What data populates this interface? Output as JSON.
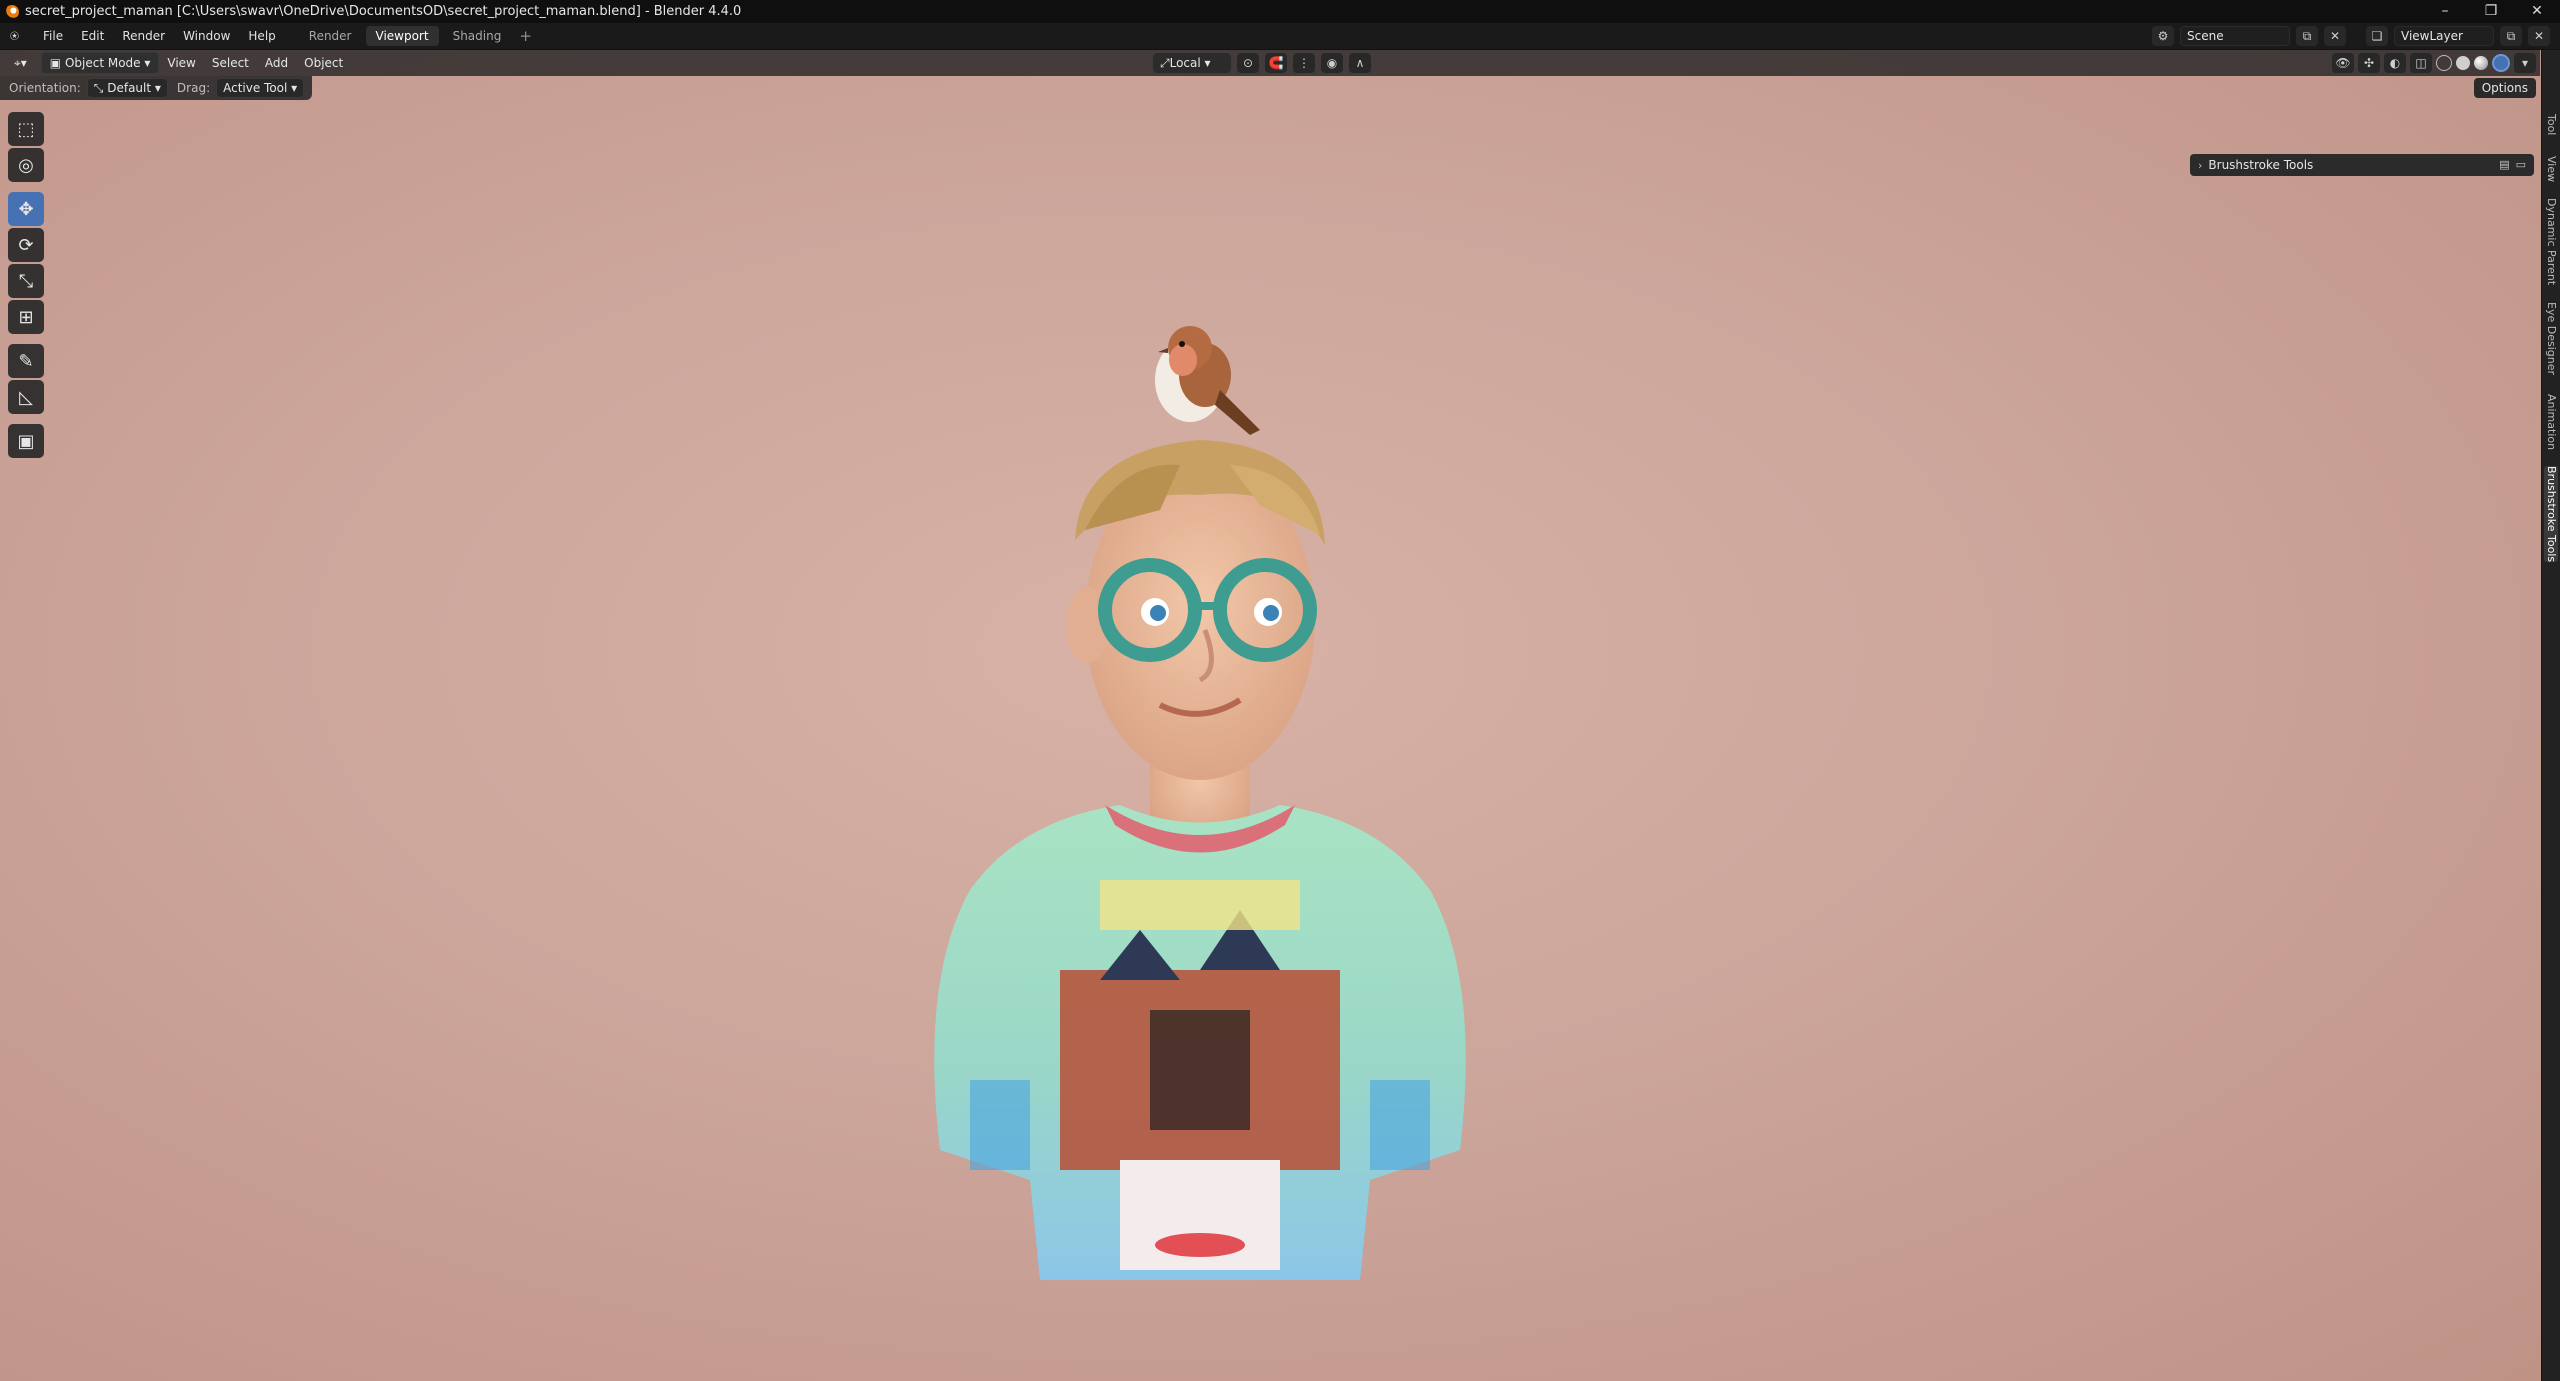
{
  "window": {
    "title": "secret_project_maman [C:\\Users\\swavr\\OneDrive\\DocumentsOD\\secret_project_maman.blend] - Blender 4.4.0",
    "controls": {
      "minimize": "–",
      "restore": "❐",
      "close": "✕"
    }
  },
  "menu": {
    "items": [
      "File",
      "Edit",
      "Render",
      "Window",
      "Help"
    ],
    "workspaces": [
      {
        "label": "Render",
        "active": false
      },
      {
        "label": "Viewport",
        "active": true
      },
      {
        "label": "Shading",
        "active": false
      }
    ],
    "add_workspace": "+",
    "scene": "Scene",
    "view_layer": "ViewLayer"
  },
  "viewport_header": {
    "mode": "Object Mode",
    "menus": [
      "View",
      "Select",
      "Add",
      "Object"
    ],
    "transform_orientation": "Local"
  },
  "tool_settings": {
    "orientation_label": "Orientation:",
    "orientation_value": "Default",
    "drag_label": "Drag:",
    "drag_value": "Active Tool",
    "options": "Options"
  },
  "toolbar": {
    "tools": [
      {
        "name": "select-box-tool",
        "glyph": "⬚",
        "active": false
      },
      {
        "name": "cursor-tool",
        "glyph": "◎",
        "active": false
      },
      {
        "name": "move-tool",
        "glyph": "✥",
        "active": true
      },
      {
        "name": "rotate-tool",
        "glyph": "⟳",
        "active": false
      },
      {
        "name": "scale-tool",
        "glyph": "⤡",
        "active": false
      },
      {
        "name": "transform-tool",
        "glyph": "⊞",
        "active": false
      },
      {
        "name": "annotate-tool",
        "glyph": "✎",
        "active": false
      },
      {
        "name": "measure-tool",
        "glyph": "📐",
        "active": false
      },
      {
        "name": "add-cube-tool",
        "glyph": "▣",
        "active": false
      }
    ]
  },
  "n_panel": {
    "tabs": [
      "Tool",
      "View",
      "Dynamic Parent",
      "Eye Designer",
      "Animation",
      "Brushstroke Tools"
    ],
    "active_tab": "Brushstroke Tools",
    "panel_title": "Brushstroke Tools"
  },
  "colors": {
    "accent": "#4672b4",
    "viewport_bg": "#cca59b",
    "ui_dark": "#1d1d1d"
  }
}
